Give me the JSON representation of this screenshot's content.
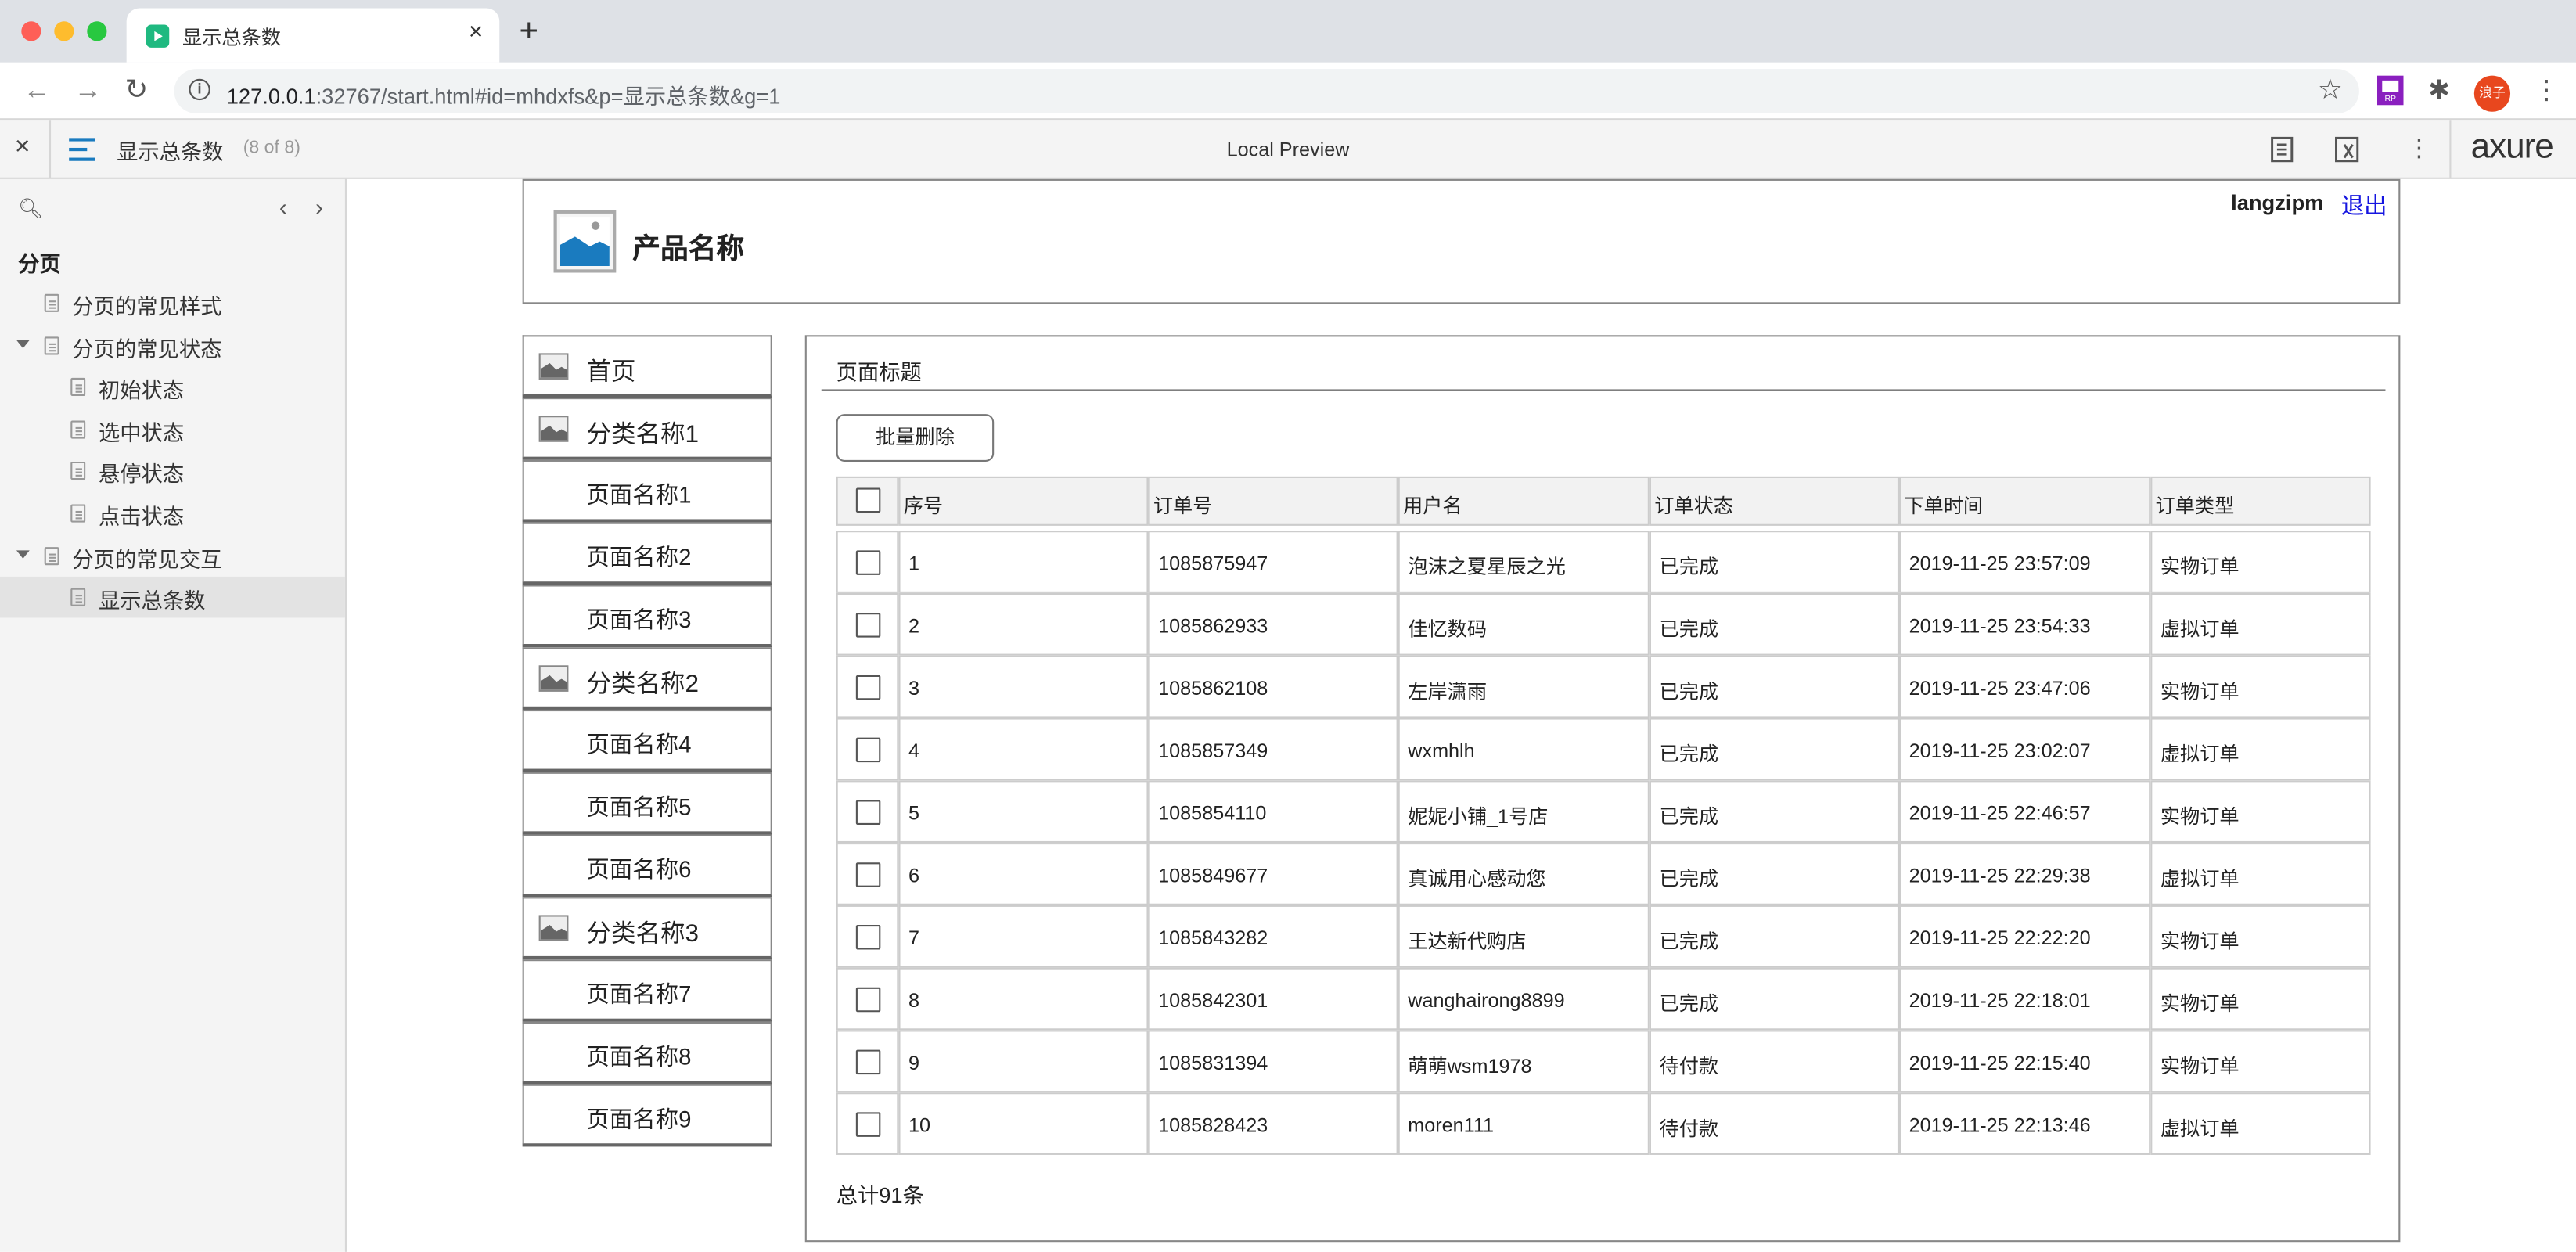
{
  "browser": {
    "tab_title": "显示总条数",
    "url_host": "127.0.0.1",
    "url_rest": ":32767/start.html#id=mhdxfs&p=显示总条数&g=1",
    "avatar_text": "浪子",
    "icons": [
      "back-icon",
      "forward-icon",
      "reload-icon",
      "info-icon",
      "star-icon",
      "extension-icon",
      "menu-icon"
    ]
  },
  "axure": {
    "page_name": "显示总条数",
    "page_count": "(8 of 8)",
    "preview_label": "Local Preview",
    "logo": "axure"
  },
  "sidebar": {
    "root": "分页",
    "items": [
      {
        "label": "分页的常见样式"
      },
      {
        "label": "分页的常见状态"
      },
      {
        "label": "初始状态"
      },
      {
        "label": "选中状态"
      },
      {
        "label": "悬停状态"
      },
      {
        "label": "点击状态"
      },
      {
        "label": "分页的常见交互"
      },
      {
        "label": "显示总条数"
      }
    ]
  },
  "header": {
    "product_name": "产品名称",
    "username": "langzipm",
    "logout": "退出"
  },
  "nav": [
    {
      "label": "首页"
    },
    {
      "label": "分类名称1"
    },
    {
      "label": "页面名称1"
    },
    {
      "label": "页面名称2"
    },
    {
      "label": "页面名称3"
    },
    {
      "label": "分类名称2"
    },
    {
      "label": "页面名称4"
    },
    {
      "label": "页面名称5"
    },
    {
      "label": "页面名称6"
    },
    {
      "label": "分类名称3"
    },
    {
      "label": "页面名称7"
    },
    {
      "label": "页面名称8"
    },
    {
      "label": "页面名称9"
    }
  ],
  "main": {
    "title": "页面标题",
    "batch_delete": "批量删除",
    "total": "总计91条",
    "columns": [
      "序号",
      "订单号",
      "用户名",
      "订单状态",
      "下单时间",
      "订单类型"
    ],
    "rows": [
      [
        "1",
        "1085875947",
        "泡沫之夏星辰之光",
        "已完成",
        "2019-11-25 23:57:09",
        "实物订单"
      ],
      [
        "2",
        "1085862933",
        "佳忆数码",
        "已完成",
        "2019-11-25 23:54:33",
        "虚拟订单"
      ],
      [
        "3",
        "1085862108",
        "左岸潇雨",
        "已完成",
        "2019-11-25 23:47:06",
        "实物订单"
      ],
      [
        "4",
        "1085857349",
        "wxmhlh",
        "已完成",
        "2019-11-25 23:02:07",
        "虚拟订单"
      ],
      [
        "5",
        "1085854110",
        "妮妮小铺_1号店",
        "已完成",
        "2019-11-25 22:46:57",
        "实物订单"
      ],
      [
        "6",
        "1085849677",
        "真诚用心感动您",
        "已完成",
        "2019-11-25 22:29:38",
        "虚拟订单"
      ],
      [
        "7",
        "1085843282",
        "王达新代购店",
        "已完成",
        "2019-11-25 22:22:20",
        "实物订单"
      ],
      [
        "8",
        "1085842301",
        "wanghairong8899",
        "已完成",
        "2019-11-25 22:18:01",
        "实物订单"
      ],
      [
        "9",
        "1085831394",
        "萌萌wsm1978",
        "待付款",
        "2019-11-25 22:15:40",
        "实物订单"
      ],
      [
        "10",
        "1085828423",
        "moren111",
        "待付款",
        "2019-11-25 22:13:46",
        "虚拟订单"
      ]
    ]
  }
}
